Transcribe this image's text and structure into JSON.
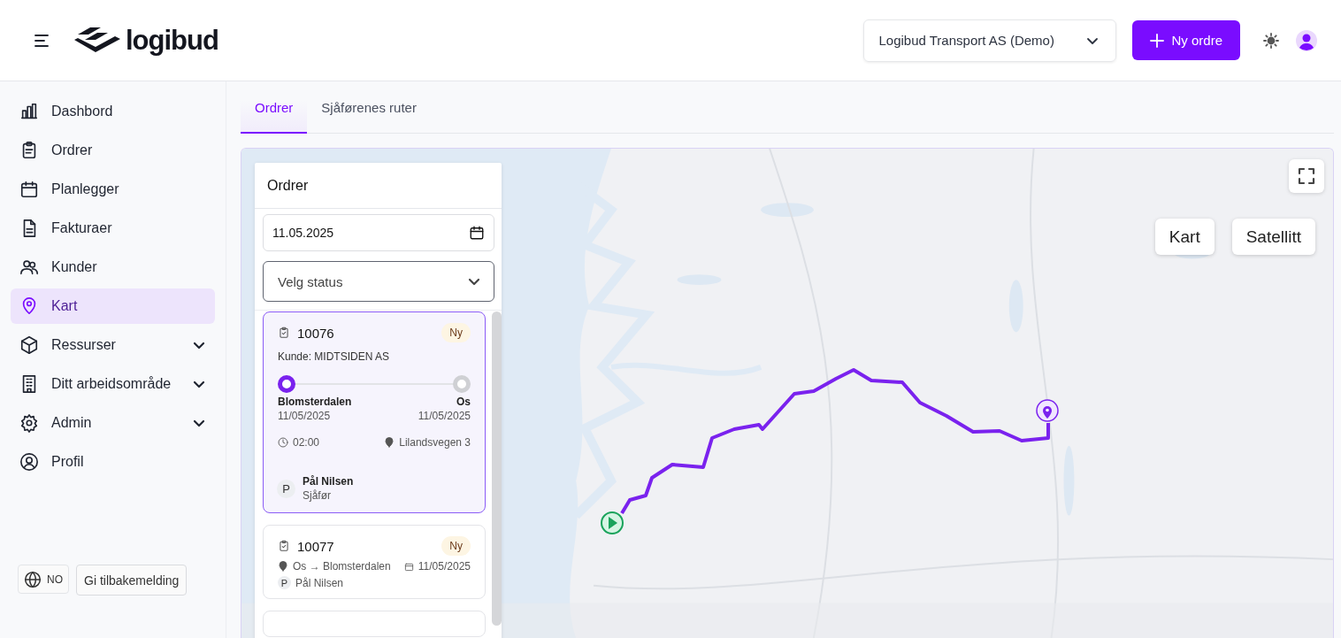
{
  "header": {
    "logo": "logibud",
    "company_select": "Logibud Transport AS (Demo)",
    "new_order_button": "Ny ordre"
  },
  "sidebar": {
    "items": [
      {
        "label": "Dashbord",
        "selected": false,
        "expandable": false
      },
      {
        "label": "Ordrer",
        "selected": false,
        "expandable": false
      },
      {
        "label": "Planlegger",
        "selected": false,
        "expandable": false
      },
      {
        "label": "Fakturaer",
        "selected": false,
        "expandable": false
      },
      {
        "label": "Kunder",
        "selected": false,
        "expandable": false
      },
      {
        "label": "Kart",
        "selected": true,
        "expandable": false
      },
      {
        "label": "Ressurser",
        "selected": false,
        "expandable": true
      },
      {
        "label": "Ditt arbeidsområde",
        "selected": false,
        "expandable": true
      },
      {
        "label": "Admin",
        "selected": false,
        "expandable": true
      },
      {
        "label": "Profil",
        "selected": false,
        "expandable": false
      }
    ],
    "language": "NO",
    "feedback_button": "Gi tilbakemelding"
  },
  "tabs": [
    {
      "label": "Ordrer",
      "selected": true
    },
    {
      "label": "Sjåførenes ruter",
      "selected": false
    }
  ],
  "map": {
    "view_buttons": [
      "Kart",
      "Satellitt"
    ]
  },
  "orders_panel": {
    "title": "Ordrer",
    "date": "11.05.2025",
    "status_placeholder": "Velg status",
    "orders": [
      {
        "kind": "detailed",
        "selected": true,
        "number": "10076",
        "status": "Ny",
        "customer": "Kunde: MIDTSIDEN AS",
        "from": "Blomsterdalen",
        "from_date": "11/05/2025",
        "to": "Os",
        "to_date": "11/05/2025",
        "time": "02:00",
        "address": "Lilandsvegen 3",
        "driver_initial": "P",
        "driver": "Pål Nilsen",
        "driver_role": "Sjåfør"
      },
      {
        "kind": "compact",
        "selected": false,
        "number": "10077",
        "status": "Ny",
        "route": "Os → Blomsterdalen",
        "date": "11/05/2025",
        "driver_initial": "P",
        "driver": "Pål Nilsen"
      },
      {
        "kind": "cut_off",
        "selected": false
      }
    ]
  }
}
